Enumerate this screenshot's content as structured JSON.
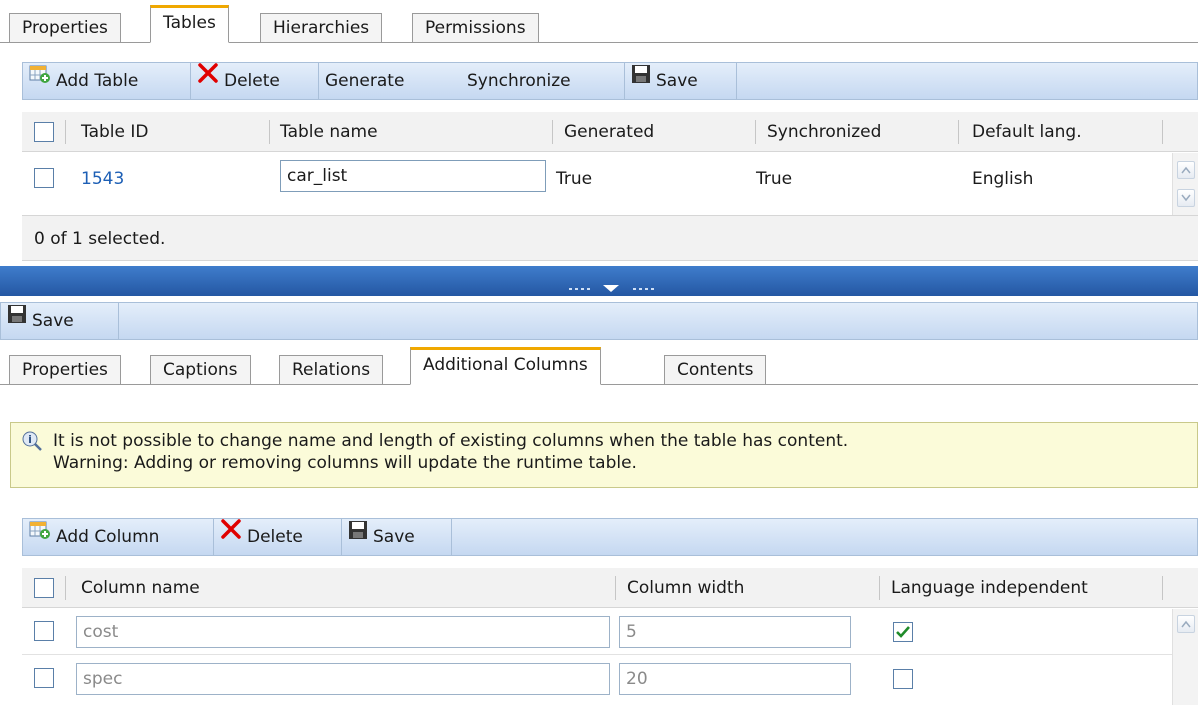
{
  "top_tabs": [
    "Properties",
    "Tables",
    "Hierarchies",
    "Permissions"
  ],
  "tables_toolbar": {
    "add": "Add Table",
    "delete": "Delete",
    "generate": "Generate",
    "synchronize": "Synchronize",
    "save": "Save"
  },
  "tables_grid": {
    "headers": [
      "Table ID",
      "Table name",
      "Generated",
      "Synchronized",
      "Default lang."
    ],
    "rows": [
      {
        "id": "1543",
        "name": "car_list",
        "generated": "True",
        "synchronized": "True",
        "lang": "English"
      }
    ],
    "status": "0 of 1 selected."
  },
  "mid_toolbar": {
    "save": "Save"
  },
  "sub_tabs": [
    "Properties",
    "Captions",
    "Relations",
    "Additional Columns",
    "Contents"
  ],
  "info": {
    "line1": "It is not possible to change name and length of existing columns when the table has content.",
    "line2": "Warning: Adding or removing columns will update the runtime table."
  },
  "columns_toolbar": {
    "add": "Add Column",
    "delete": "Delete",
    "save": "Save"
  },
  "columns_grid": {
    "headers": [
      "Column name",
      "Column width",
      "Language independent"
    ],
    "rows": [
      {
        "name": "cost",
        "width": "5",
        "lang_independent": true
      },
      {
        "name": "spec",
        "width": "20",
        "lang_independent": false
      }
    ]
  },
  "colors": {
    "accent": "#f0a800",
    "toolbar": "#c5d8f1",
    "splitter": "#2d6bbf",
    "link": "#1d5fb5",
    "delete": "#e00000",
    "info_bg": "#fbfbd9",
    "check_green": "#1f8b2a"
  },
  "icons": [
    "add-table-icon",
    "delete-icon",
    "save-icon",
    "info-icon",
    "collapse-arrow-icon"
  ]
}
